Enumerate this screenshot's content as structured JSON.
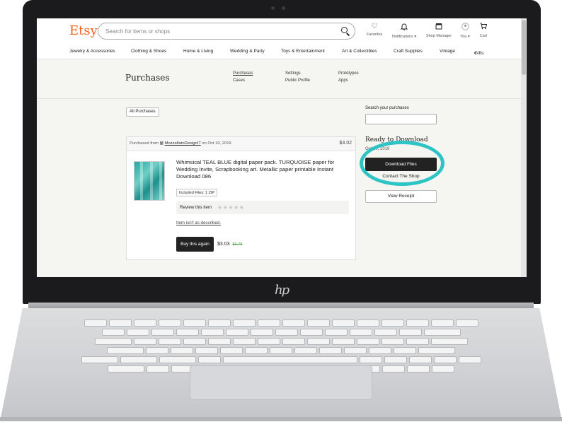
{
  "brand": {
    "name": "Etsy",
    "color": "#f1641e"
  },
  "search": {
    "placeholder": "Search for items or shops"
  },
  "header_icons": [
    {
      "icon": "heart-icon",
      "label": "Favorites"
    },
    {
      "icon": "bell-icon",
      "label": "Notifications ▾"
    },
    {
      "icon": "shop-icon",
      "label": "Shop Manager"
    },
    {
      "icon": "user-icon",
      "label": "You ▾"
    },
    {
      "icon": "cart-icon",
      "label": "Cart"
    }
  ],
  "nav": [
    "Jewelry & Accessories",
    "Clothing & Shoes",
    "Home & Living",
    "Wedding & Party",
    "Toys & Entertainment",
    "Art & Collectibles",
    "Craft Supplies",
    "Vintage",
    "Gifts"
  ],
  "subheader": {
    "title": "Purchases",
    "links": [
      "Purchases",
      "Cases",
      "Settings",
      "Public Profile",
      "Prototypes",
      "Apps"
    ]
  },
  "filter": {
    "label": "All Purchases"
  },
  "order": {
    "purchased_from_prefix": "Purchased from",
    "shop_name": "MozzafiatoDesignIT",
    "date_text": "on Oct 10, 2019",
    "total": "$3.02",
    "item_title": "Whimsical TEAL BLUE digital paper pack. TURQUOISE paper for Wedding Invite, Scrapbooking art. Metallic paper printable Instant Download 086",
    "included_files": "Included Files: 1 ZIP",
    "review_label": "Review this item",
    "stars": "★★★★★",
    "not_described": "Item isn't as described.",
    "buy_again": "Buy this again",
    "price": "$3.03",
    "old_price": "$3.79"
  },
  "sidebar": {
    "search_label": "Search your purchases",
    "ready_title": "Ready to Download",
    "ready_date": "Oct 10, 2019",
    "download_button": "Download Files",
    "contact_link": "Contact The Shop",
    "receipt_button": "View Receipt"
  },
  "colors": {
    "highlight": "#2ec4c6",
    "button_dark": "#222222",
    "page_bg": "#f5f5f1"
  }
}
